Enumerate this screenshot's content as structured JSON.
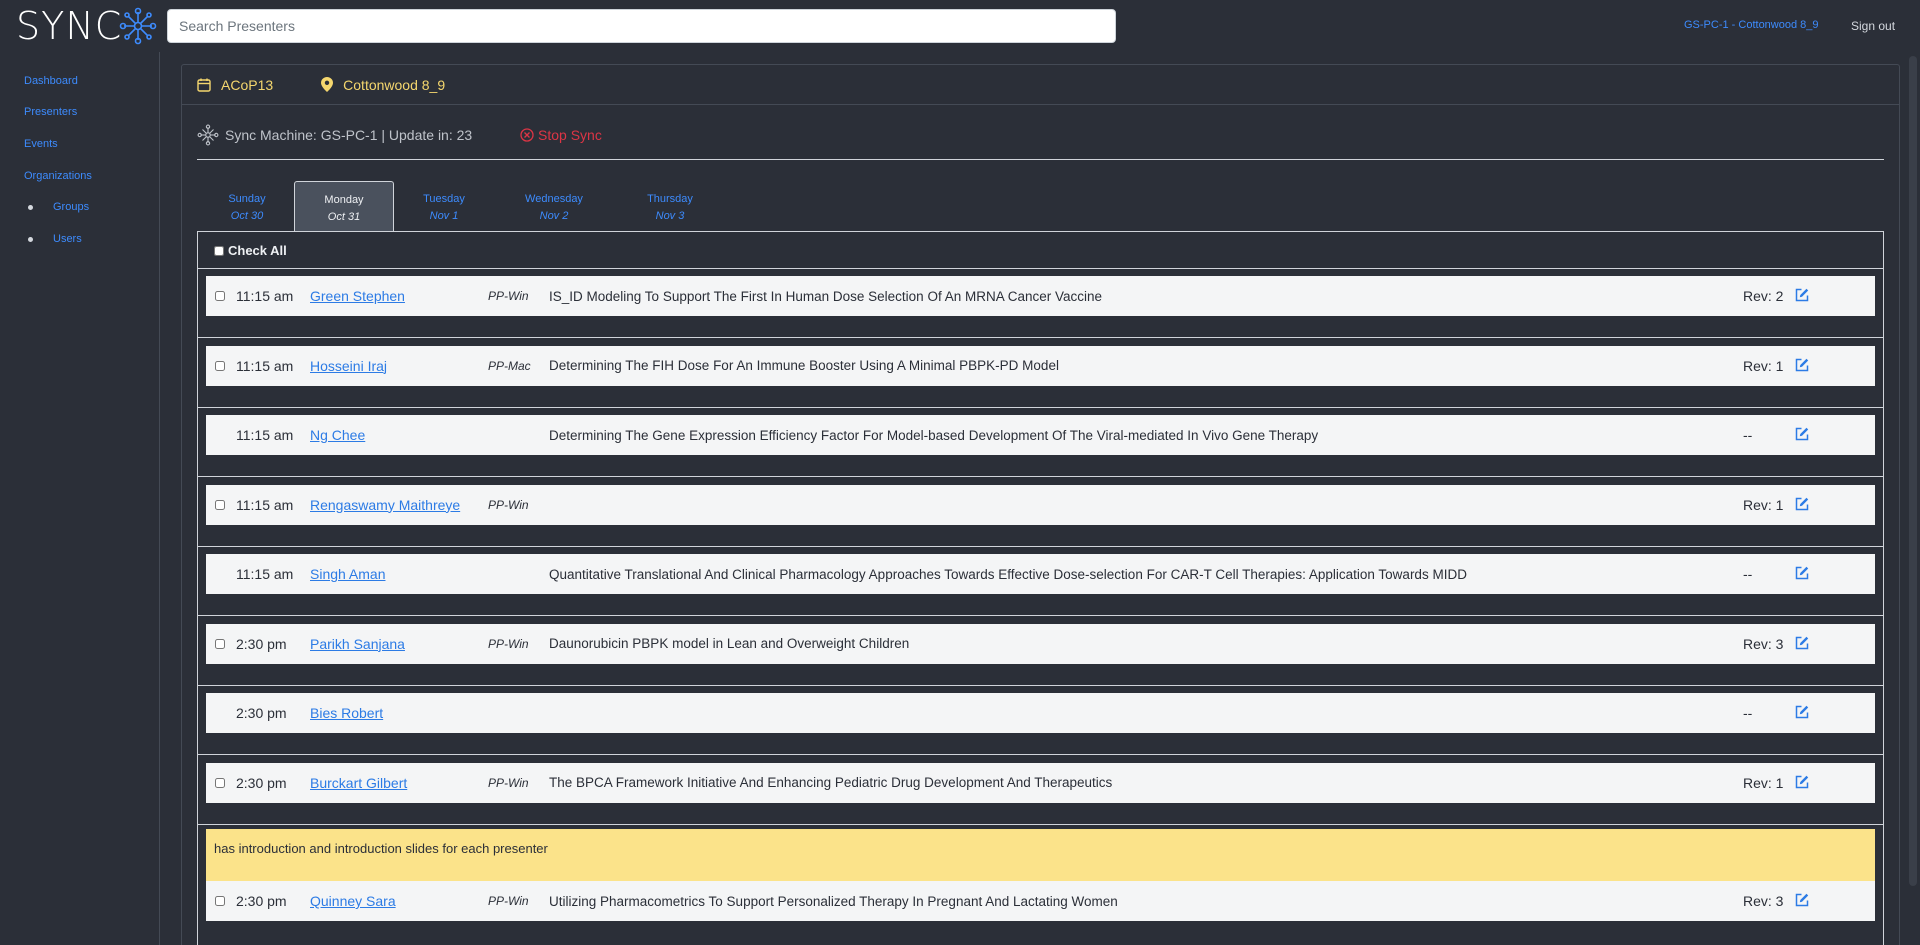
{
  "app": {
    "logo_text": "SYNC"
  },
  "search": {
    "placeholder": "Search Presenters"
  },
  "header": {
    "machine_link": "GS-PC-1 - Cottonwood 8_9",
    "signout": "Sign out"
  },
  "sidebar": {
    "items": [
      "Dashboard",
      "Presenters",
      "Events",
      "Organizations"
    ],
    "sub_items": [
      "Groups",
      "Users"
    ]
  },
  "panel": {
    "event": "ACoP13",
    "room": "Cottonwood 8_9",
    "sync_text": "Sync Machine: GS-PC-1 | Update in: 23",
    "stop_sync": "Stop Sync"
  },
  "tabs": [
    {
      "day": "Sunday",
      "date": "Oct 30"
    },
    {
      "day": "Monday",
      "date": "Oct 31",
      "active": true
    },
    {
      "day": "Tuesday",
      "date": "Nov 1"
    },
    {
      "day": "Wednesday",
      "date": "Nov 2"
    },
    {
      "day": "Thursday",
      "date": "Nov 3"
    }
  ],
  "list": {
    "check_all": "Check All",
    "rows": [
      {
        "time": "11:15 am",
        "name": "Green Stephen",
        "platform": "PP-Win",
        "title": "IS_ID Modeling To Support The First In Human Dose Selection Of An MRNA Cancer Vaccine",
        "rev": "Rev: 2",
        "checkbox": true
      },
      {
        "time": "11:15 am",
        "name": "Hosseini Iraj",
        "platform": "PP-Mac",
        "title": "Determining The FIH Dose For An Immune Booster Using A Minimal PBPK-PD Model",
        "rev": "Rev: 1",
        "checkbox": true
      },
      {
        "time": "11:15 am",
        "name": "Ng Chee",
        "platform": "",
        "title": "Determining The Gene Expression Efficiency Factor For Model-based Development Of The Viral-mediated In Vivo Gene Therapy",
        "rev": "--",
        "checkbox": false
      },
      {
        "time": "11:15 am",
        "name": "Rengaswamy Maithreye",
        "platform": "PP-Win",
        "title": "",
        "rev": "Rev: 1",
        "checkbox": true
      },
      {
        "time": "11:15 am",
        "name": "Singh Aman",
        "platform": "",
        "title": "Quantitative Translational And Clinical Pharmacology Approaches Towards Effective Dose-selection For CAR-T Cell Therapies: Application Towards MIDD",
        "rev": "--",
        "checkbox": false
      },
      {
        "time": "2:30 pm",
        "name": "Parikh Sanjana",
        "platform": "PP-Win",
        "title": "Daunorubicin PBPK model in Lean and Overweight Children",
        "rev": "Rev: 3",
        "checkbox": true
      },
      {
        "time": "2:30 pm",
        "name": "Bies Robert",
        "platform": "",
        "title": "",
        "rev": "--",
        "checkbox": false
      },
      {
        "time": "2:30 pm",
        "name": "Burckart Gilbert",
        "platform": "PP-Win",
        "title": "The BPCA Framework Initiative And Enhancing Pediatric Drug Development And Therapeutics",
        "rev": "Rev: 1",
        "checkbox": true
      }
    ],
    "note": "has introduction and introduction slides for each presenter",
    "last_row": {
      "time": "2:30 pm",
      "name": "Quinney Sara",
      "platform": "PP-Win",
      "title": "Utilizing Pharmacometrics To Support Personalized Therapy In Pregnant And Lactating Women",
      "rev": "Rev: 3",
      "checkbox": true
    }
  },
  "colors": {
    "background": "#2b2f38",
    "link": "#3d8bfd",
    "accent": "#f5d76e",
    "danger": "#dc3545",
    "note": "#fbe38a"
  },
  "icons": {
    "logo": "network-node-icon",
    "calendar": "calendar-icon",
    "location": "map-pin-icon",
    "sync": "network-node-icon",
    "stop": "circle-x-icon",
    "edit": "edit-icon"
  }
}
